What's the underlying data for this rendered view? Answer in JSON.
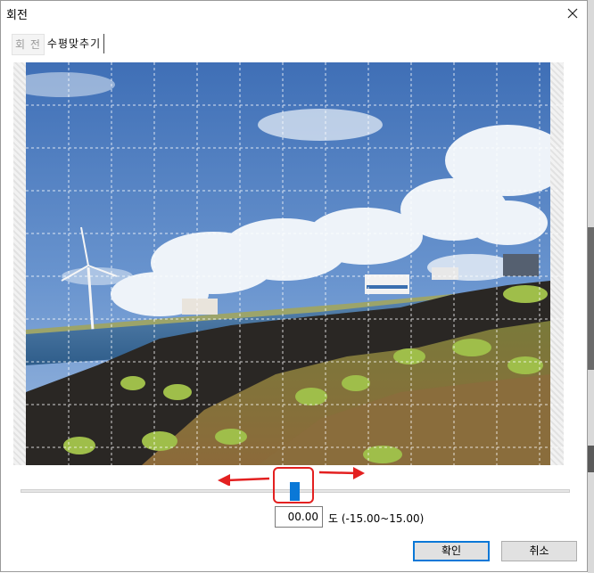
{
  "window": {
    "title": "회전"
  },
  "tabs": [
    {
      "label": "회 전"
    },
    {
      "label": "수평맞추기"
    }
  ],
  "rotation": {
    "value": "00.00",
    "unit_range": "도 (-15.00~15.00)"
  },
  "buttons": {
    "ok": "확인",
    "cancel": "취소"
  },
  "icons": {
    "close": "close-icon"
  },
  "colors": {
    "accent": "#0a78d7",
    "highlight": "#e32020"
  }
}
